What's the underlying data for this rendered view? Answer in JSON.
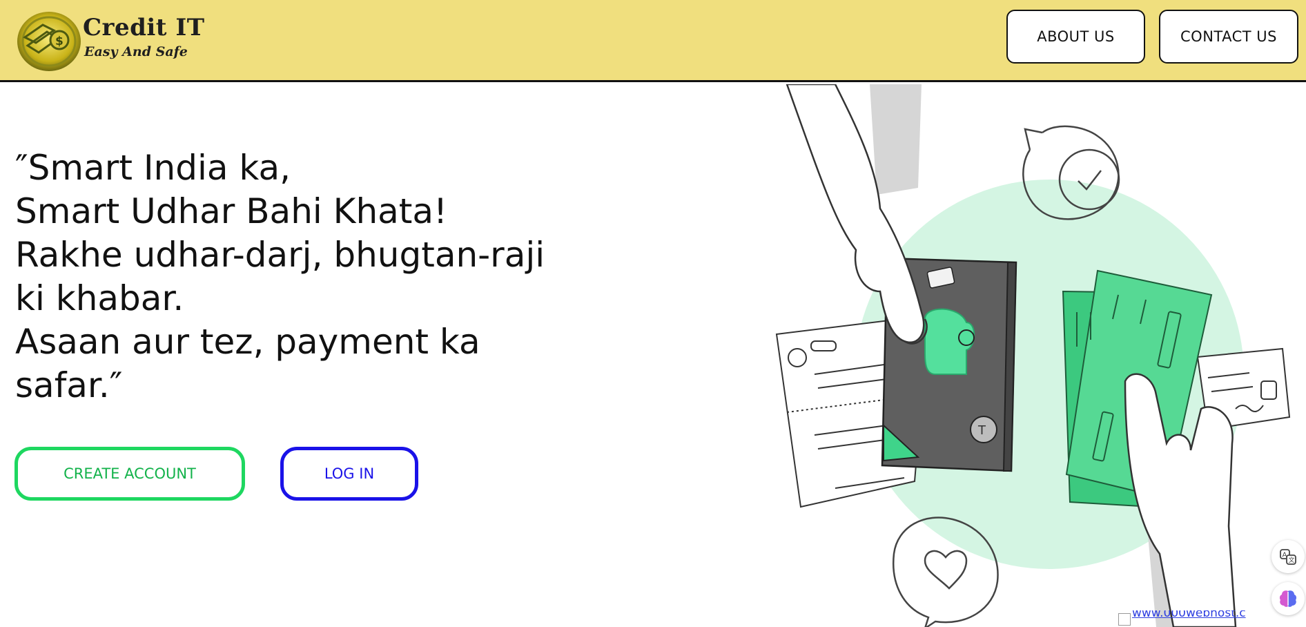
{
  "header": {
    "brand_title": "Credit IT",
    "brand_tagline": "Easy And Safe",
    "nav": {
      "about_label": "ABOUT US",
      "contact_label": "CONTACT US"
    }
  },
  "hero": {
    "lines": [
      "″Smart India ka,",
      "Smart Udhar Bahi Khata!",
      "Rakhe udhar-darj, bhugtan-raji",
      "ki khabar.",
      "Asaan aur tez, payment ka",
      "safar.″"
    ],
    "create_account_label": "CREATE ACCOUNT",
    "login_label": "LOG IN"
  },
  "floating": {
    "broken_image_alt": "www.000webhost.c",
    "icons": [
      "translate-icon",
      "brain-icon"
    ]
  },
  "colors": {
    "header_bg": "#f0df7e",
    "create_border": "#1ed760",
    "login_border": "#1a12e8",
    "mint_circle": "#d4f5e3",
    "money_green": "#3cc97f"
  }
}
